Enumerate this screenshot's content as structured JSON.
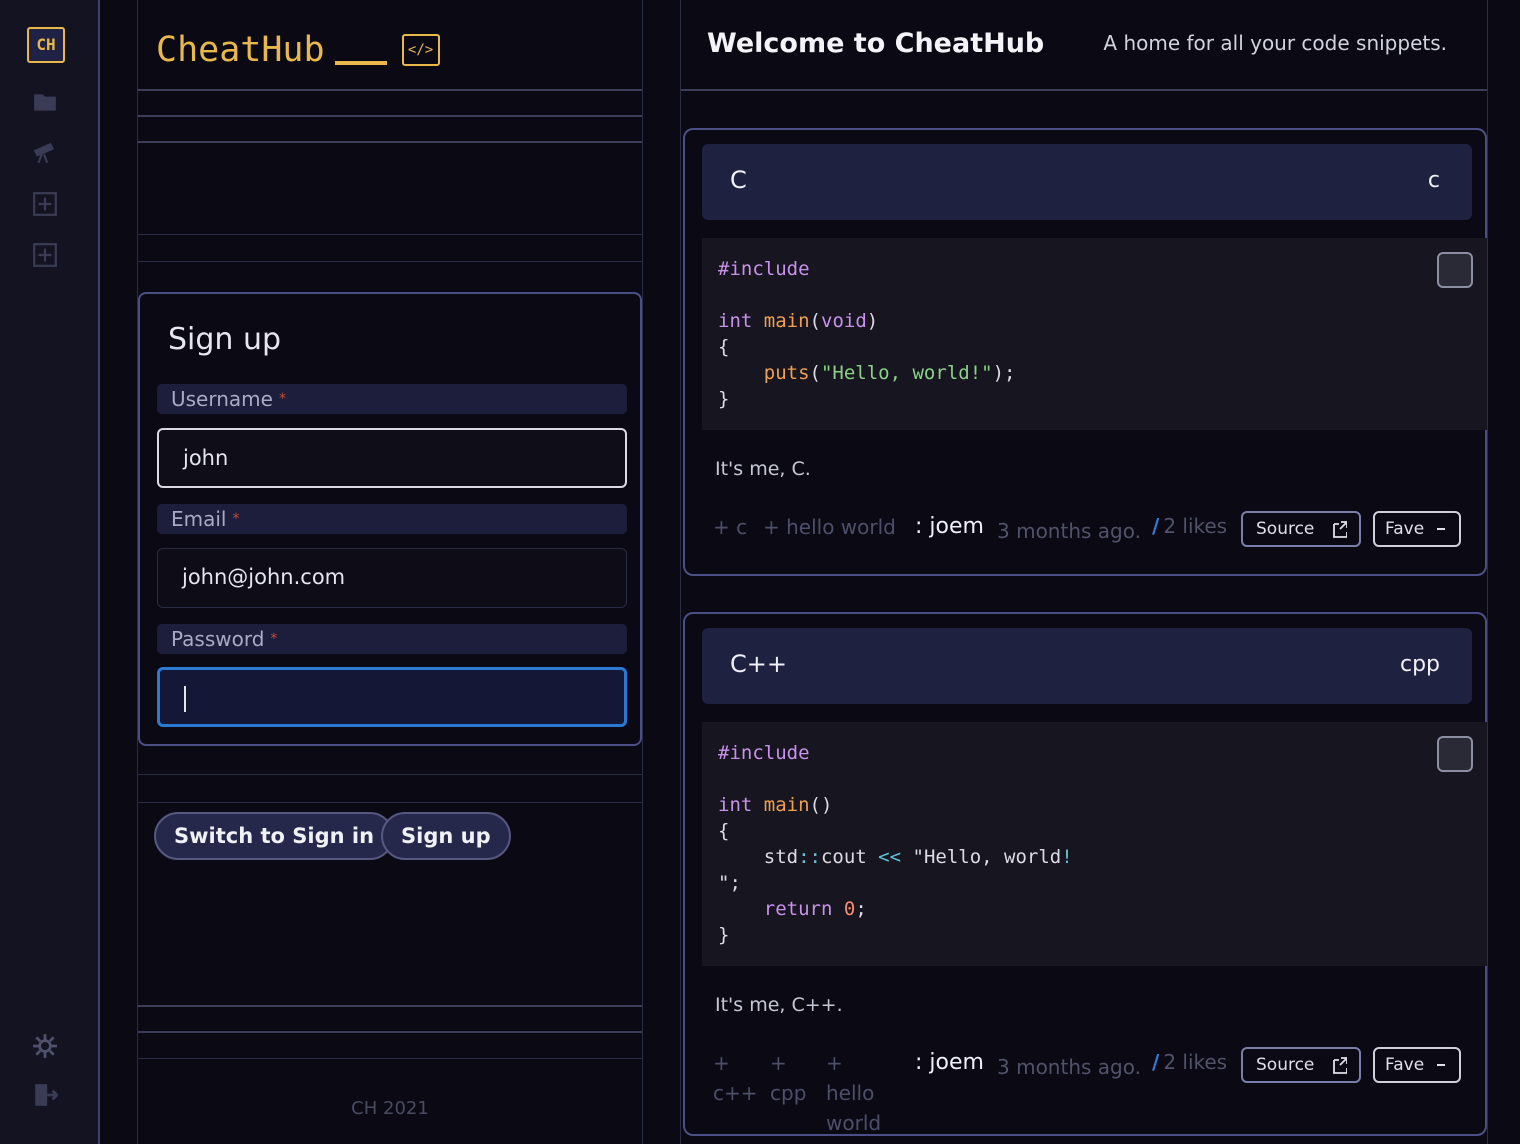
{
  "rail": {
    "logo": "CH",
    "icons": [
      "folder-icon",
      "telescope-icon",
      "plus-box-icon",
      "plus-box-icon",
      "gear-icon",
      "logout-icon"
    ]
  },
  "brand": {
    "title": "CheatHub",
    "code_glyph": "</>"
  },
  "signup": {
    "title": "Sign up",
    "username_label": "Username",
    "username_value": "john",
    "email_label": "Email",
    "email_value": "john@john.com",
    "password_label": "Password",
    "password_value": "",
    "required_mark": "*"
  },
  "actions": {
    "switch_label": "Switch to Sign in",
    "signup_label": "Sign up"
  },
  "footer": {
    "text": "CH 2021"
  },
  "header": {
    "welcome": "Welcome to CheatHub",
    "tagline": "A home for all your code snippets."
  },
  "snippets": [
    {
      "name": "C",
      "lang": "c",
      "description": "It's me, C.",
      "tags": [
        "+ c",
        "+ hello world"
      ],
      "author": ": joem",
      "ago": "3 months ago.",
      "likes": "2 likes",
      "source_label": "Source",
      "fave_label": "Fave"
    },
    {
      "name": "C++",
      "lang": "cpp",
      "description": "It's me, C++.",
      "tags": [
        "+ c++",
        "+ cpp",
        "+ hello world"
      ],
      "author": ": joem",
      "ago": "3 months ago.",
      "likes": "2 likes",
      "source_label": "Source",
      "fave_label": "Fave"
    }
  ],
  "colors": {
    "accent_gold": "#e8b84a",
    "card_border": "#4b4f85",
    "focus_blue": "#2a7ad4",
    "likes_slash": "#2f7de0"
  }
}
